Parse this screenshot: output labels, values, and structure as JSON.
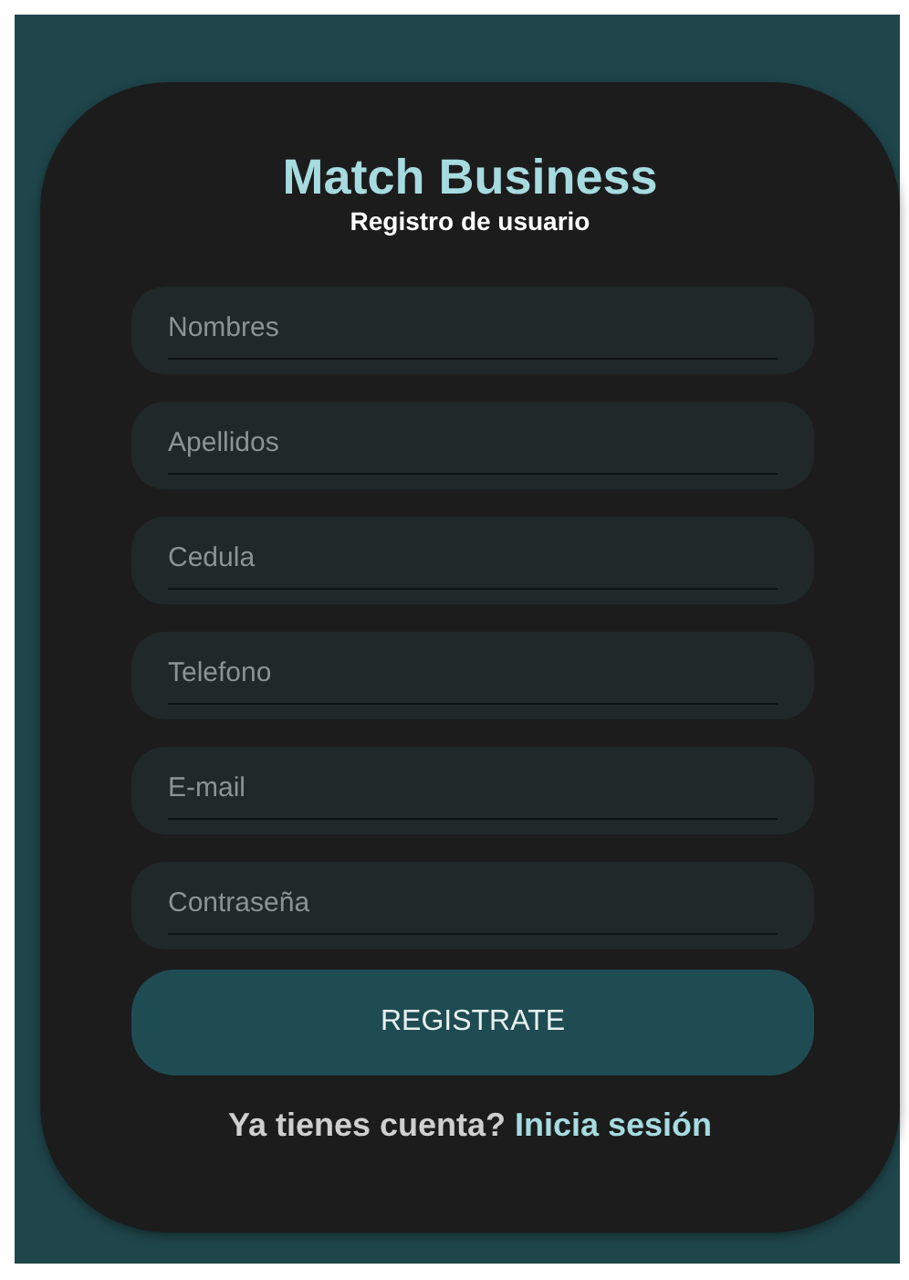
{
  "title": "Match Business",
  "subtitle": "Registro de usuario",
  "fields": [
    {
      "placeholder": "Nombres"
    },
    {
      "placeholder": "Apellidos"
    },
    {
      "placeholder": "Cedula"
    },
    {
      "placeholder": "Telefono"
    },
    {
      "placeholder": "E-mail"
    },
    {
      "placeholder": "Contraseña"
    }
  ],
  "button": "REGISTRATE",
  "footer": {
    "text": "Ya tienes cuenta?",
    "link": "Inicia sesión"
  }
}
